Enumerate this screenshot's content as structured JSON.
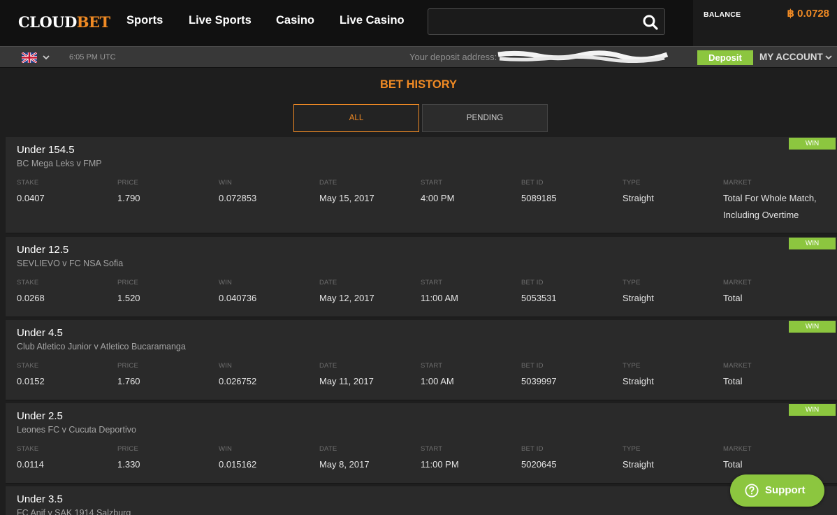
{
  "header": {
    "logo": {
      "part1": "CLOUD",
      "part2": "BET"
    },
    "nav": [
      "Sports",
      "Live Sports",
      "Casino",
      "Live Casino"
    ],
    "search": {
      "value": "",
      "placeholder": ""
    },
    "balance_label": "BALANCE",
    "balance_value": "฿ 0.0728"
  },
  "subbar": {
    "time": "6:05 PM UTC",
    "deposit_label": "Your deposit address:",
    "deposit_button": "Deposit",
    "account_label": "MY ACCOUNT"
  },
  "page": {
    "title": "BET HISTORY",
    "tabs": [
      "ALL",
      "PENDING"
    ]
  },
  "columns": [
    "STAKE",
    "PRICE",
    "WIN",
    "DATE",
    "START",
    "BET ID",
    "TYPE",
    "MARKET"
  ],
  "bets": [
    {
      "title": "Under 154.5",
      "event": "BC Mega Leks v FMP",
      "status": "WIN",
      "values": [
        "0.0407",
        "1.790",
        "0.072853",
        "May 15, 2017",
        "4:00 PM",
        "5089185",
        "Straight",
        "Total For Whole Match, Including Overtime"
      ]
    },
    {
      "title": "Under 12.5",
      "event": "SEVLIEVO v FC NSA Sofia",
      "status": "WIN",
      "values": [
        "0.0268",
        "1.520",
        "0.040736",
        "May 12, 2017",
        "11:00 AM",
        "5053531",
        "Straight",
        "Total"
      ]
    },
    {
      "title": "Under 4.5",
      "event": "Club Atletico Junior v Atletico Bucaramanga",
      "status": "WIN",
      "values": [
        "0.0152",
        "1.760",
        "0.026752",
        "May 11, 2017",
        "1:00 AM",
        "5039997",
        "Straight",
        "Total"
      ]
    },
    {
      "title": "Under 2.5",
      "event": "Leones FC v Cucuta Deportivo",
      "status": "WIN",
      "values": [
        "0.0114",
        "1.330",
        "0.015162",
        "May 8, 2017",
        "11:00 PM",
        "5020645",
        "Straight",
        "Total"
      ]
    },
    {
      "title": "Under 3.5",
      "event": "FC Anif v SAK 1914 Salzburg"
    }
  ],
  "support_label": "Support",
  "colors": {
    "accent": "#f08a24",
    "win_green": "#8cc63f",
    "background": "#1e1e1e",
    "card": "#2a2a2a"
  },
  "icons": {
    "search": "search-icon",
    "flag": "uk-flag-icon",
    "support": "question-circle-icon"
  }
}
